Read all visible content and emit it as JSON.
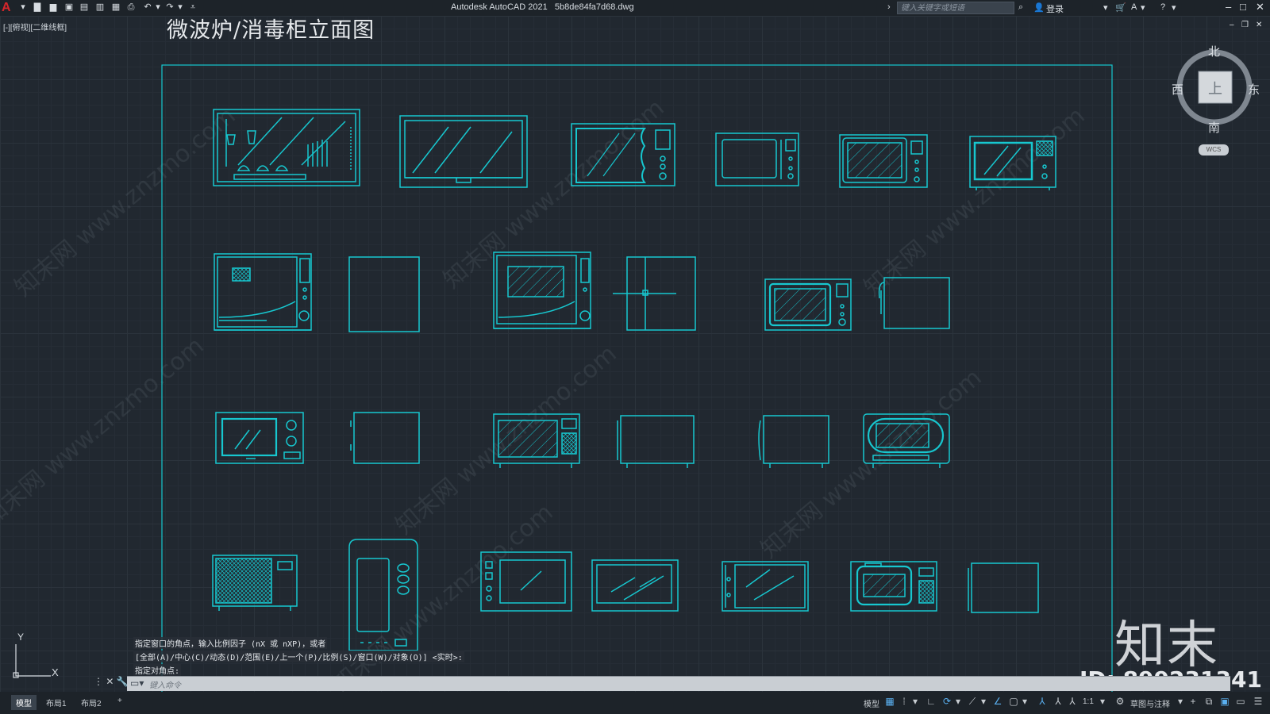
{
  "titlebar": {
    "app_title": "Autodesk AutoCAD 2021",
    "file_name": "5b8de84fa7d68.dwg",
    "search_placeholder": "键入关键字或短语",
    "login": "登录"
  },
  "viewport_label": "[-][俯视][二维线框]",
  "drawing_title": "微波炉/消毒柜立面图",
  "viewcube": {
    "north": "北",
    "south": "南",
    "east": "东",
    "west": "西",
    "face": "上",
    "wcs": "WCS"
  },
  "ucs": {
    "x": "X",
    "y": "Y"
  },
  "command_history": [
    "指定窗口的角点，输入比例因子 (nX 或 nXP)，或者",
    "[全部(A)/中心(C)/动态(D)/范围(E)/上一个(P)/比例(S)/窗口(W)/对象(O)] <实时>:",
    "指定对角点:"
  ],
  "command_input_placeholder": "键入命令",
  "layout_tabs": [
    {
      "label": "模型",
      "active": true
    },
    {
      "label": "布局1",
      "active": false
    },
    {
      "label": "布局2",
      "active": false
    },
    {
      "label": "+",
      "active": false
    }
  ],
  "status": {
    "model": "模型",
    "scale": "1:1",
    "workspace": "草图与注释"
  },
  "watermark": {
    "logo": "知末",
    "id": "ID: 899231341",
    "site": "知末网 www.znzmo.com"
  },
  "colors": {
    "background": "#212830",
    "drawing_line": "#17c7cf",
    "titlebar": "#1d2329"
  }
}
